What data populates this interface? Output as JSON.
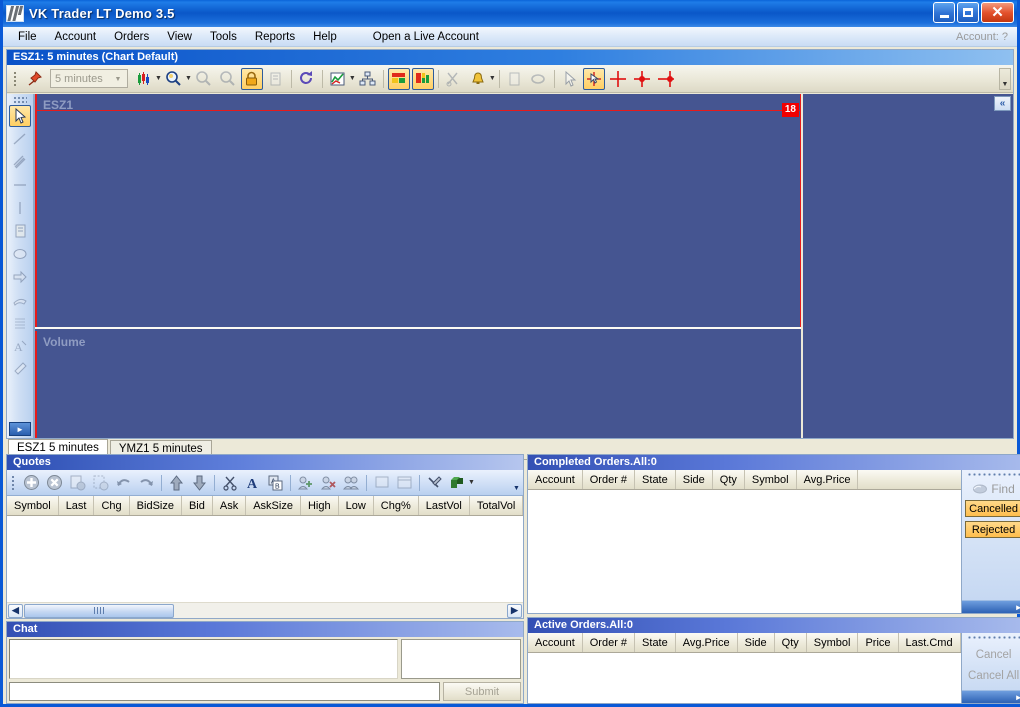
{
  "window": {
    "title": "VK Trader LT Demo 3.5",
    "logo_name": "vk-logo",
    "buttons": {
      "minimize": "minimize",
      "maximize": "maximize",
      "close": "close"
    }
  },
  "menubar": {
    "items": [
      "File",
      "Account",
      "Orders",
      "View",
      "Tools",
      "Reports",
      "Help"
    ],
    "live_account": "Open a Live Account",
    "account_status": "Account: ?"
  },
  "chart": {
    "caption": "ESZ1: 5 minutes (Chart Default)",
    "timeframe_value": "5 minutes",
    "price_pane_label": "ESZ1",
    "volume_pane_label": "Volume",
    "price_tag": "18",
    "collapse_label": "«",
    "toolbar_icons": [
      "pin-icon",
      "timeframe-combo",
      "candlestick-chart-icon",
      "zoom-icon",
      "zoom-in-icon",
      "zoom-out-icon",
      "lock-icon",
      "copy-icon",
      "refresh-icon",
      "chart-style-icon",
      "hierarchy-icon",
      "bar-color-icon",
      "volume-color-icon",
      "cut-icon",
      "alert-bell-icon",
      "note-icon",
      "link-icon",
      "pointer-icon",
      "crosshair-select-icon",
      "crosshair-icon",
      "crosshair-buy-icon",
      "crosshair-sell-icon"
    ],
    "draw_tools": [
      "pointer-tool",
      "trendline-tool",
      "parallel-lines-tool",
      "horizontal-line-tool",
      "vertical-line-tool",
      "note-tool",
      "ellipse-tool",
      "arrow-tool",
      "fan-tool",
      "grid-tool",
      "text-tool",
      "eraser-tool"
    ]
  },
  "chart_tabs": [
    {
      "label": "ESZ1 5 minutes",
      "active": true
    },
    {
      "label": "YMZ1 5 minutes",
      "active": false
    }
  ],
  "quotes": {
    "caption": "Quotes",
    "columns": [
      "Symbol",
      "Last",
      "Chg",
      "BidSize",
      "Bid",
      "Ask",
      "AskSize",
      "High",
      "Low",
      "Chg%",
      "LastVol",
      "TotalVol"
    ],
    "rows": [],
    "toolbar_icons": [
      "add-icon",
      "delete-icon",
      "remove-row-icon",
      "clear-selection-icon",
      "undo-icon",
      "redo-icon",
      "move-up-icon",
      "move-down-icon",
      "cut-icon",
      "font-icon",
      "rename-icon",
      "add-group-icon",
      "remove-group-icon",
      "group-settings-icon",
      "monitor-icon",
      "window-icon",
      "tools-icon",
      "export-icon"
    ]
  },
  "chat": {
    "caption": "Chat",
    "log_value": "",
    "users_value": "",
    "input_value": "",
    "submit_label": "Submit"
  },
  "completed_orders": {
    "caption": "Completed Orders.All:0",
    "columns": [
      "Account",
      "Order #",
      "State",
      "Side",
      "Qty",
      "Symbol",
      "Avg.Price"
    ],
    "rows": [],
    "find_label": "Find",
    "cancelled_label": "Cancelled",
    "rejected_label": "Rejected"
  },
  "active_orders": {
    "caption": "Active Orders.All:0",
    "columns": [
      "Account",
      "Order #",
      "State",
      "Avg.Price",
      "Side",
      "Qty",
      "Symbol",
      "Price",
      "Last.Cmd"
    ],
    "rows": [],
    "cancel_label": "Cancel",
    "cancel_all_label": "Cancel All"
  },
  "colors": {
    "title_blue": "#0a57c8",
    "chart_bg": "#455591",
    "accent_red": "#e81a1a",
    "orange_btn": "#ffbe4d"
  }
}
